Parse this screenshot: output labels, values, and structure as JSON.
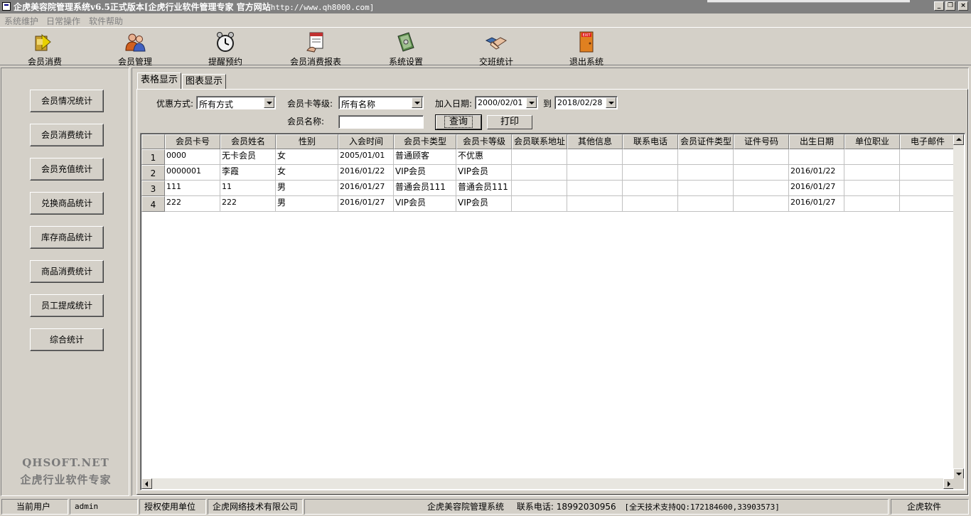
{
  "window": {
    "title_text": "企虎美容院管理系统v6.5正式版本[企虎行业软件管理专家 官方网站",
    "title_url": "http://www.qh8000.com]"
  },
  "menu": [
    "系统维护",
    "日常操作",
    "软件帮助"
  ],
  "toolbar": [
    {
      "label": "会员消费",
      "icon": "arrow-card-icon"
    },
    {
      "label": "会员管理",
      "icon": "users-icon"
    },
    {
      "label": "提醒预约",
      "icon": "alarm-clock-icon"
    },
    {
      "label": "会员消费报表",
      "icon": "report-icon"
    },
    {
      "label": "系统设置",
      "icon": "settings-book-icon"
    },
    {
      "label": "交班统计",
      "icon": "handshake-icon"
    },
    {
      "label": "退出系统",
      "icon": "exit-door-icon",
      "icon_text": "EXIT"
    }
  ],
  "sidebar": {
    "buttons": [
      "会员情况统计",
      "会员消费统计",
      "会员充值统计",
      "兑换商品统计",
      "库存商品统计",
      "商品消费统计",
      "员工提成统计",
      "综合统计"
    ],
    "watermark_line1": "QHSOFT.NET",
    "watermark_line2": "企虎行业软件专家"
  },
  "tabs": [
    "表格显示",
    "图表显示"
  ],
  "filters": {
    "discount_label": "优惠方式:",
    "discount_value": "所有方式",
    "level_label": "会员卡等级:",
    "level_value": "所有名称",
    "join_date_label": "加入日期:",
    "date_from": "2000/02/01",
    "to_label": "到",
    "date_to": "2018/02/28",
    "name_label": "会员名称:",
    "name_value": "",
    "query_button": "查询",
    "print_button": "打印"
  },
  "grid": {
    "columns": [
      "会员卡号",
      "会员姓名",
      "性别",
      "入会时间",
      "会员卡类型",
      "会员卡等级",
      "会员联系地址",
      "其他信息",
      "联系电话",
      "会员证件类型",
      "证件号码",
      "出生日期",
      "单位职业",
      "电子邮件"
    ],
    "rows": [
      {
        "n": "1",
        "cells": [
          "0000",
          "无卡会员",
          "女",
          "2005/01/01",
          "普通顾客",
          "不优惠",
          "",
          "",
          "",
          "",
          "",
          "",
          "",
          ""
        ]
      },
      {
        "n": "2",
        "cells": [
          "0000001",
          "李霞",
          "女",
          "2016/01/22",
          "VIP会员",
          "VIP会员",
          "",
          "",
          "",
          "",
          "",
          "2016/01/22",
          "",
          ""
        ]
      },
      {
        "n": "3",
        "cells": [
          "111",
          "11",
          "男",
          "2016/01/27",
          "普通会员111",
          "普通会员111",
          "",
          "",
          "",
          "",
          "",
          "2016/01/27",
          "",
          ""
        ]
      },
      {
        "n": "4",
        "cells": [
          "222",
          "222",
          "男",
          "2016/01/27",
          "VIP会员",
          "VIP会员",
          "",
          "",
          "",
          "",
          "",
          "2016/01/27",
          "",
          ""
        ]
      }
    ]
  },
  "status": {
    "user_label": "当前用户",
    "user_value": "admin",
    "license_label": "授权使用单位",
    "license_value": "企虎网络技术有限公司",
    "system_name": "企虎美容院管理系统",
    "phone": "联系电话: 18992030956",
    "support": "[全天技术支持QQ:172184600,33903573]",
    "brand": "企虎软件"
  },
  "colors": {
    "face": "#d4d0c8",
    "titlebar": "#808080",
    "grid_bg": "#ffffff"
  }
}
